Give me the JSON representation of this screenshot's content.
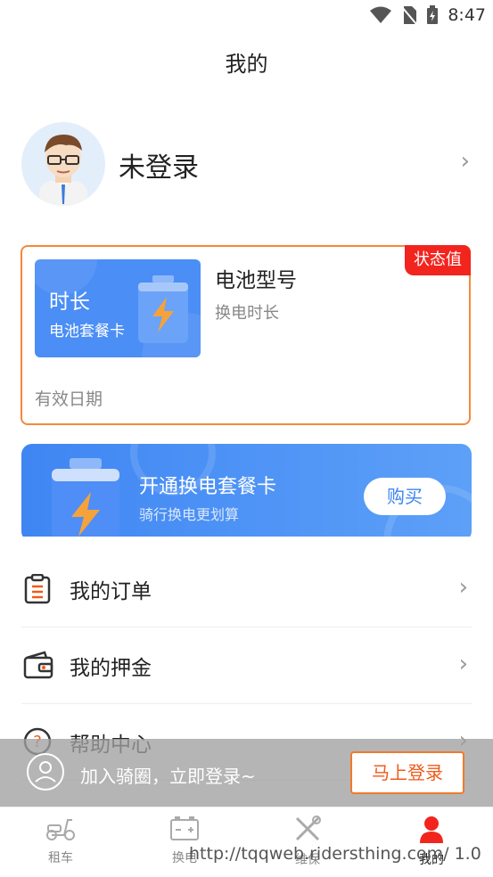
{
  "status_bar": {
    "time": "8:47"
  },
  "header": {
    "title": "我的"
  },
  "profile": {
    "status": "未登录"
  },
  "package_card": {
    "badge": "状态值",
    "card_title": "时长",
    "card_subtitle": "电池套餐卡",
    "battery_type": "电池型号",
    "swap_duration": "换电时长",
    "valid_date": "有效日期"
  },
  "promo": {
    "title": "开通换电套餐卡",
    "subtitle": "骑行换电更划算",
    "buy_label": "购买"
  },
  "menu": {
    "items": [
      {
        "label": "我的订单"
      },
      {
        "label": "我的押金"
      },
      {
        "label": "帮助中心"
      }
    ]
  },
  "login_banner": {
    "prompt": "加入骑圈，立即登录~",
    "button": "马上登录"
  },
  "tabbar": {
    "items": [
      {
        "label": "租车"
      },
      {
        "label": "换电"
      },
      {
        "label": "维保"
      },
      {
        "label": "我的"
      }
    ]
  },
  "url_overlay": "http://tqqweb.ridersthing.com/ 1.0",
  "colors": {
    "accent": "#f5883b",
    "brand_blue": "#4b8ef5",
    "badge_red": "#f2241e"
  }
}
